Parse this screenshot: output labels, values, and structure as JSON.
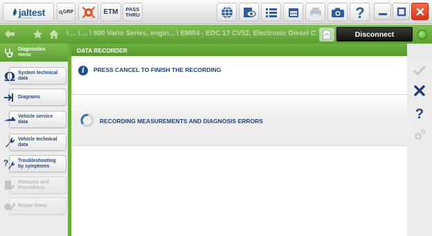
{
  "app": {
    "logo_text": "jaltest",
    "logo_sub": "by ALLEGRO",
    "grp_label": "GRP",
    "etm_label": "ETM",
    "pass_thru_line1": "PASS",
    "pass_thru_line2": "THRU"
  },
  "nav": {
    "breadcrumb": "\\ ... \\ ... \\ 900 Vario Series, engin... \\ EMR4 - EDC 17 CV52, Electronic Diesel Co...",
    "disconnect_label": "Disconnect"
  },
  "sidebar": {
    "header_line1": "Diagnostics",
    "header_line2": "menu",
    "items": [
      {
        "line1": "System technical",
        "line2": "data",
        "icon": "omega-icon",
        "enabled": true
      },
      {
        "line1": "Diagrams",
        "line2": "",
        "icon": "diagram-arrow-icon",
        "enabled": true
      },
      {
        "line1": "Vehicle service",
        "line2": "data",
        "icon": "service-icon",
        "enabled": true
      },
      {
        "line1": "Vehicle technical",
        "line2": "data",
        "icon": "wrench-icon",
        "enabled": true
      },
      {
        "line1": "Troubleshooting",
        "line2": "by symptoms",
        "icon": "troubleshooting-icon",
        "enabled": true
      },
      {
        "line1": "Releases and",
        "line2": "Procedures",
        "icon": "releases-icon",
        "enabled": false
      },
      {
        "line1": "Repair times",
        "line2": "",
        "icon": "repair-times-icon",
        "enabled": false
      }
    ]
  },
  "main": {
    "header": "DATA RECORDER",
    "info_message": "PRESS CANCEL TO FINISH THE RECORDING",
    "status_message": "RECORDING MEASUREMENTS AND DIAGNOSIS ERRORS"
  },
  "colors": {
    "accent_green": "#6aad3c",
    "text_blue": "#1f3f7f",
    "close_red": "#e8452c"
  }
}
